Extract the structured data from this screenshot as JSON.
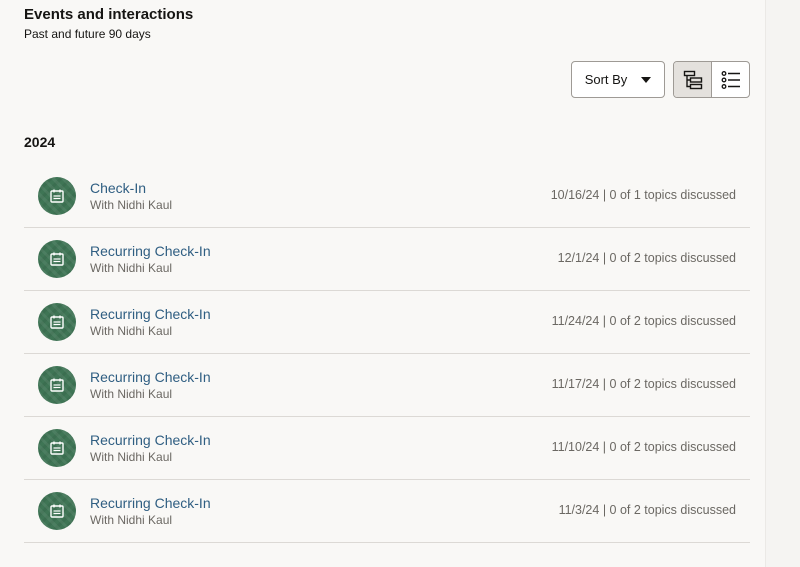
{
  "header": {
    "title": "Events and interactions",
    "subtitle": "Past and future 90 days"
  },
  "toolbar": {
    "sort_label": "Sort By",
    "view_modes": [
      {
        "name": "hierarchy-view-icon",
        "active": true
      },
      {
        "name": "list-view-icon",
        "active": false
      }
    ]
  },
  "colors": {
    "accent_link": "#2f5e82",
    "avatar_bg": "#3f7555",
    "active_toggle_bg": "#e4e1dd"
  },
  "group": {
    "year": "2024"
  },
  "events": [
    {
      "title": "Check-In",
      "with": "With Nidhi Kaul",
      "meta": "10/16/24 | 0 of 1 topics discussed",
      "icon": "calendar-icon"
    },
    {
      "title": "Recurring Check-In",
      "with": "With Nidhi Kaul",
      "meta": "12/1/24 | 0 of 2 topics discussed",
      "icon": "calendar-icon"
    },
    {
      "title": "Recurring Check-In",
      "with": "With Nidhi Kaul",
      "meta": "11/24/24 | 0 of 2 topics discussed",
      "icon": "calendar-icon"
    },
    {
      "title": "Recurring Check-In",
      "with": "With Nidhi Kaul",
      "meta": "11/17/24 | 0 of 2 topics discussed",
      "icon": "calendar-icon"
    },
    {
      "title": "Recurring Check-In",
      "with": "With Nidhi Kaul",
      "meta": "11/10/24 | 0 of 2 topics discussed",
      "icon": "calendar-icon"
    },
    {
      "title": "Recurring Check-In",
      "with": "With Nidhi Kaul",
      "meta": "11/3/24 | 0 of 2 topics discussed",
      "icon": "calendar-icon"
    }
  ]
}
